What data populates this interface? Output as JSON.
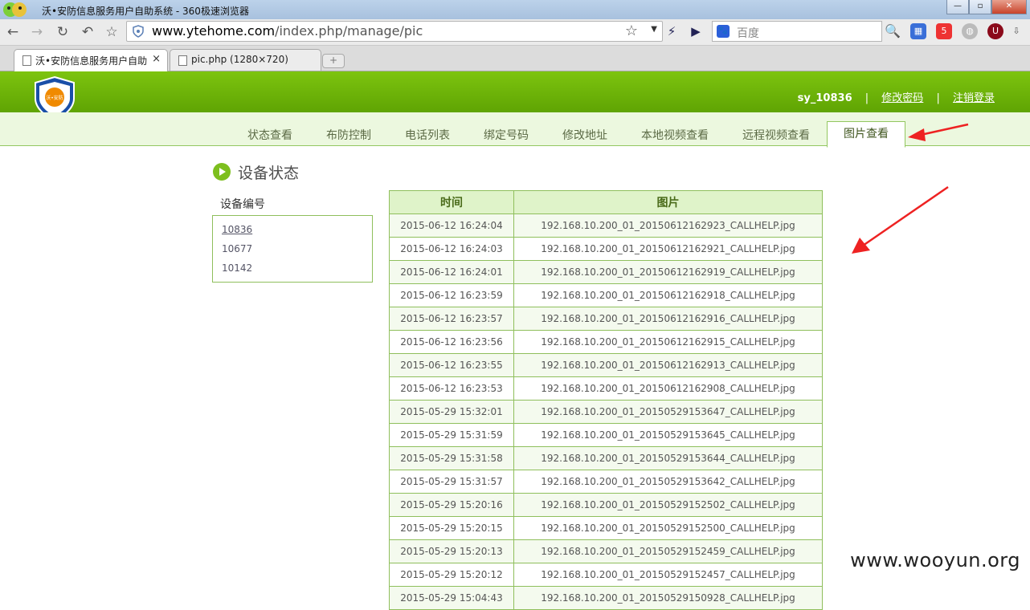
{
  "browser": {
    "window_title": "沃•安防信息服务用户自助系统 - 360极速浏览器",
    "address": {
      "host": "www.ytehome.com",
      "path": "/index.php/manage/pic"
    },
    "search_placeholder": "百度",
    "tabs": [
      {
        "label": "沃•安防信息服务用户自助",
        "close": "×",
        "active": true
      },
      {
        "label": "pic.php (1280×720)",
        "active": false
      }
    ],
    "new_tab_label": "+",
    "window_buttons": {
      "minimize": "—",
      "maximize": "▫",
      "close": "✕"
    },
    "ext_badge": "5"
  },
  "site": {
    "logo_text": "沃•安防",
    "user": {
      "username": "sy_10836",
      "separator": "|",
      "change_password": "修改密码",
      "logout": "注销登录"
    },
    "menu": [
      {
        "label": "状态查看"
      },
      {
        "label": "布防控制"
      },
      {
        "label": "电话列表"
      },
      {
        "label": "绑定号码"
      },
      {
        "label": "修改地址"
      },
      {
        "label": "本地视频查看"
      },
      {
        "label": "远程视频查看"
      },
      {
        "label": "图片查看",
        "active": true
      }
    ]
  },
  "content": {
    "section_title": "设备状态",
    "device_label": "设备编号",
    "devices": [
      "10836",
      "10677",
      "10142"
    ],
    "table": {
      "headers": {
        "time": "时间",
        "pic": "图片"
      },
      "rows": [
        {
          "time": "2015-06-12 16:24:04",
          "pic": "192.168.10.200_01_20150612162923_CALLHELP.jpg"
        },
        {
          "time": "2015-06-12 16:24:03",
          "pic": "192.168.10.200_01_20150612162921_CALLHELP.jpg"
        },
        {
          "time": "2015-06-12 16:24:01",
          "pic": "192.168.10.200_01_20150612162919_CALLHELP.jpg"
        },
        {
          "time": "2015-06-12 16:23:59",
          "pic": "192.168.10.200_01_20150612162918_CALLHELP.jpg"
        },
        {
          "time": "2015-06-12 16:23:57",
          "pic": "192.168.10.200_01_20150612162916_CALLHELP.jpg"
        },
        {
          "time": "2015-06-12 16:23:56",
          "pic": "192.168.10.200_01_20150612162915_CALLHELP.jpg"
        },
        {
          "time": "2015-06-12 16:23:55",
          "pic": "192.168.10.200_01_20150612162913_CALLHELP.jpg"
        },
        {
          "time": "2015-06-12 16:23:53",
          "pic": "192.168.10.200_01_20150612162908_CALLHELP.jpg"
        },
        {
          "time": "2015-05-29 15:32:01",
          "pic": "192.168.10.200_01_20150529153647_CALLHELP.jpg"
        },
        {
          "time": "2015-05-29 15:31:59",
          "pic": "192.168.10.200_01_20150529153645_CALLHELP.jpg"
        },
        {
          "time": "2015-05-29 15:31:58",
          "pic": "192.168.10.200_01_20150529153644_CALLHELP.jpg"
        },
        {
          "time": "2015-05-29 15:31:57",
          "pic": "192.168.10.200_01_20150529153642_CALLHELP.jpg"
        },
        {
          "time": "2015-05-29 15:20:16",
          "pic": "192.168.10.200_01_20150529152502_CALLHELP.jpg"
        },
        {
          "time": "2015-05-29 15:20:15",
          "pic": "192.168.10.200_01_20150529152500_CALLHELP.jpg"
        },
        {
          "time": "2015-05-29 15:20:13",
          "pic": "192.168.10.200_01_20150529152459_CALLHELP.jpg"
        },
        {
          "time": "2015-05-29 15:20:12",
          "pic": "192.168.10.200_01_20150529152457_CALLHELP.jpg"
        },
        {
          "time": "2015-05-29 15:04:43",
          "pic": "192.168.10.200_01_20150529150928_CALLHELP.jpg"
        }
      ]
    }
  },
  "watermark": "www.wooyun.org",
  "colors": {
    "header_green": "#6db209",
    "menu_bg": "#ecf8df",
    "border_green": "#8fbf5c",
    "annotation_red": "#ee2222"
  }
}
